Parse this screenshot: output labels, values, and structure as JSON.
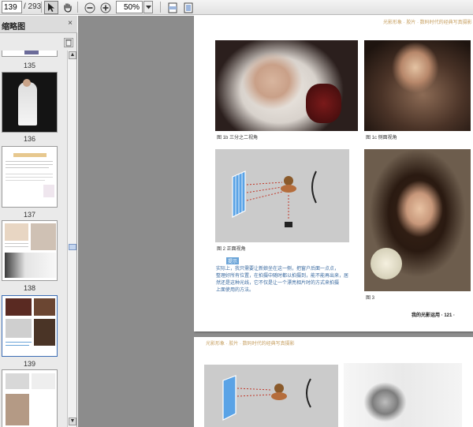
{
  "toolbar": {
    "current_page": "139",
    "total_pages": "/ 293",
    "zoom": "50%",
    "icons": [
      "select-arrow-icon",
      "hand-tool-icon",
      "zoom-out-icon",
      "zoom-in-icon",
      "fit-page-icon",
      "fit-width-icon"
    ]
  },
  "sidebar": {
    "title": "缩略图",
    "close": "×",
    "thumbnails": [
      {
        "label": "135"
      },
      {
        "label": "136"
      },
      {
        "label": "137"
      },
      {
        "label": "138"
      },
      {
        "label": "139"
      }
    ]
  },
  "page_top": {
    "header_note": "光影形象 · 胶片 · 数码时代的经典写真摄影",
    "captions": {
      "fig_1b": "图 1b 三分之二视角",
      "fig_1c": "图 1c 侧面视角",
      "fig_2": "图 2 正面视角",
      "fig_3": "图 3"
    },
    "tag": "提示",
    "body_lines": [
      "实际上，我只需要让新娘坐在这一侧，把窗户后面一点点，",
      "整理好所有位置，在拍摄中随时都以拍摄到，能不能再出来，居",
      "然还是这种光线，它不仅是让一个漂亮相片时的方式来拍摄",
      "上面使用的方法。"
    ],
    "footer": "我的光影运用 · 121 ·"
  },
  "page_bottom": {
    "header_note": "光影形象 · 胶片 · 数码时代的经典写真摄影"
  },
  "colors": {
    "accent_blue": "#6aa4d8",
    "header_gold": "#c7a062",
    "workspace_gray": "#8c8c8c"
  }
}
